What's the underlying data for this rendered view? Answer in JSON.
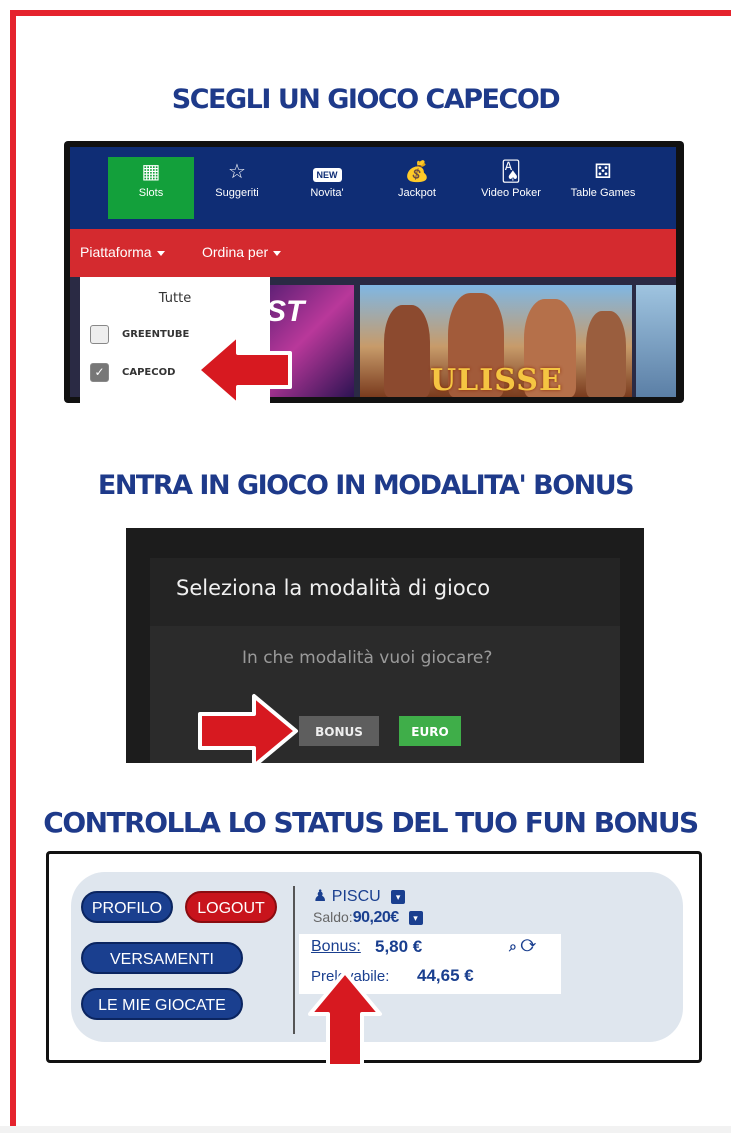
{
  "headings": {
    "step1": "SCEGLI UN GIOCO CAPECOD",
    "step2": "ENTRA IN GIOCO IN MODALITA' BONUS",
    "step3": "CONTROLLA LO STATUS DEL TUO FUN BONUS"
  },
  "casino_nav": {
    "items": [
      {
        "label": "Slots",
        "icon": "slot-machine-icon",
        "active": true
      },
      {
        "label": "Suggeriti",
        "icon": "stars-icon"
      },
      {
        "label": "Novita'",
        "icon": "new-badge-icon",
        "badge": "NEW"
      },
      {
        "label": "Jackpot",
        "icon": "money-bag-icon"
      },
      {
        "label": "Video Poker",
        "icon": "cards-icon"
      },
      {
        "label": "Table Games",
        "icon": "dice-icon"
      }
    ]
  },
  "filter_bar": {
    "platform_label": "Piattaforma",
    "sort_label": "Ordina per"
  },
  "platform_dropdown": {
    "all_label": "Tutte",
    "options": [
      {
        "label": "GREENTUBE",
        "checked": false
      },
      {
        "label": "CAPECOD",
        "checked": true
      }
    ]
  },
  "game_thumbs": {
    "title_partial": "ULISSE",
    "partial_text_left": "ST"
  },
  "mode_dialog": {
    "title": "Seleziona la modalità di gioco",
    "question": "In che modalità vuoi giocare?",
    "bonus_button": "BONUS",
    "euro_button": "EURO"
  },
  "account_panel": {
    "profile_button": "PROFILO",
    "logout_button": "LOGOUT",
    "deposits_button": "VERSAMENTI",
    "bets_button": "LE MIE GIOCATE",
    "username": "PISCU",
    "saldo_label": "Saldo:",
    "saldo_value": "90,20€",
    "bonus_label": "Bonus:",
    "bonus_value": "5,80 €",
    "withdrawable_label": "Prelevabile:",
    "withdrawable_value": "44,65 €"
  },
  "colors": {
    "frame_red": "#e5232d",
    "heading_blue": "#1e3a8a",
    "nav_blue": "#0f2d75",
    "active_green": "#13a03b",
    "bar_red": "#d42a2f",
    "arrow_red": "#d71920",
    "euro_green": "#3fae49"
  }
}
